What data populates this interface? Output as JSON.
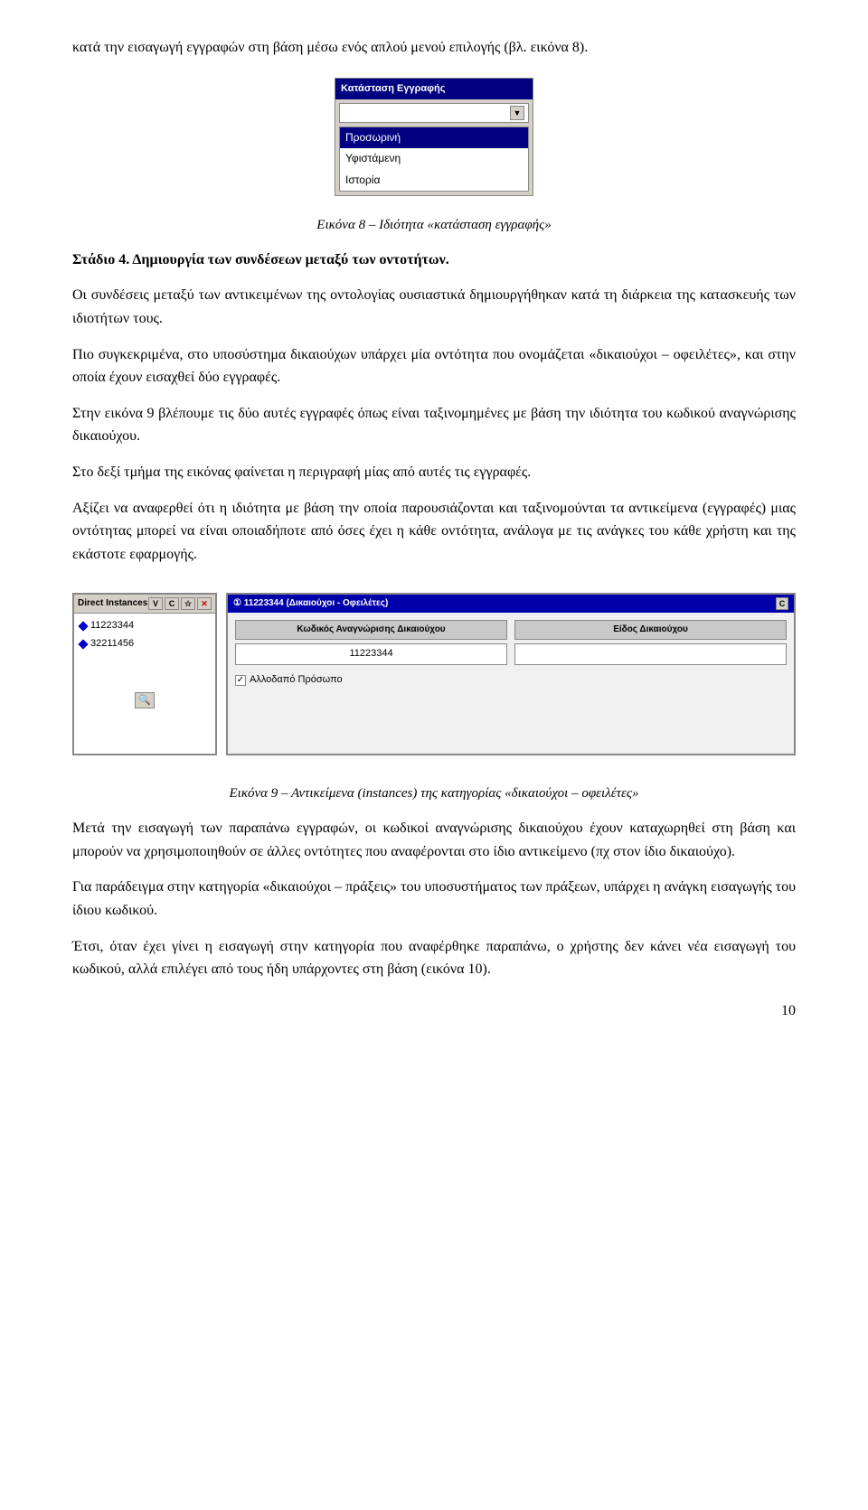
{
  "page": {
    "intro_text": "κατά την εισαγωγή εγγραφών στη βάση μέσω ενός απλού μενού επιλογής (βλ. εικόνα 8).",
    "fig8_title": "Κατάσταση Εγγραφής",
    "fig8_items": [
      "Προσωρινή",
      "Υφιστάμενη",
      "Ιστορία"
    ],
    "fig8_selected_index": 0,
    "fig8_label": "Εικόνα 8 – Ιδιότητα «κατάσταση εγγραφής»",
    "stage4_heading": "Στάδιο 4. Δημιουργία των συνδέσεων μεταξύ των οντοτήτων.",
    "para1": "Οι συνδέσεις μεταξύ των αντικειμένων της οντολογίας ουσιαστικά δημιουργήθηκαν κατά τη διάρκεια της κατασκευής των ιδιοτήτων τους.",
    "para2": "Πιο συγκεκριμένα, στο υποσύστημα δικαιούχων υπάρχει μία οντότητα που ονομάζεται «δικαιούχοι – οφειλέτες», και στην οποία έχουν εισαχθεί δύο εγγραφές.",
    "para3": "Στην εικόνα 9 βλέπουμε τις δύο αυτές εγγραφές όπως είναι ταξινομημένες με βάση την ιδιότητα του κωδικού αναγνώρισης δικαιούχου.",
    "para4": "Στο δεξί τμήμα της εικόνας φαίνεται η περιγραφή μίας από αυτές τις εγγραφές.",
    "para5": "Αξίζει να αναφερθεί ότι η ιδιότητα με βάση την οποία παρουσιάζονται και ταξινομούνται τα αντικείμενα (εγγραφές) μιας οντότητας μπορεί να είναι οποιαδήποτε από όσες έχει η κάθε οντότητα, ανάλογα με τις ανάγκες του κάθε χρήστη και της εκάστοτε εφαρμογής.",
    "fig9_left_title": "Direct Instances",
    "fig9_left_btns": [
      "V",
      "C",
      "☆",
      "✕"
    ],
    "fig9_instances": [
      "11223344",
      "32211456"
    ],
    "fig9_right_title": "① 11223344 (Δικαιούχοι - Οφειλέτες)",
    "fig9_right_close": "C",
    "fig9_col1_header": "Κωδικός Αναγνώρισης Δικαιούχου",
    "fig9_col2_header": "Είδος Δικαιούχου",
    "fig9_col1_value": "11223344",
    "fig9_col2_value": "",
    "fig9_checkbox_label": "Αλλοδαπό Πρόσωπο",
    "fig9_label": "Εικόνα 9 – Αντικείμενα (instances) της κατηγορίας «δικαιούχοι – οφειλέτες»",
    "para6": "Μετά την εισαγωγή των παραπάνω εγγραφών, οι κωδικοί αναγνώρισης δικαιούχου έχουν καταχωρηθεί στη βάση και μπορούν να χρησιμοποιηθούν σε άλλες οντότητες που αναφέρονται στο ίδιο αντικείμενο (πχ στον ίδιο δικαιούχο).",
    "para7": "Για παράδειγμα στην κατηγορία «δικαιούχοι – πράξεις» του υποσυστήματος των πράξεων, υπάρχει η ανάγκη εισαγωγής του ίδιου κωδικού.",
    "para8": "Έτσι, όταν έχει γίνει η εισαγωγή στην κατηγορία που αναφέρθηκε παραπάνω, ο χρήστης δεν κάνει νέα εισαγωγή του κωδικού, αλλά επιλέγει από τους ήδη υπάρχοντες στη βάση (εικόνα 10).",
    "page_number": "10",
    "tou_word": "τους"
  }
}
